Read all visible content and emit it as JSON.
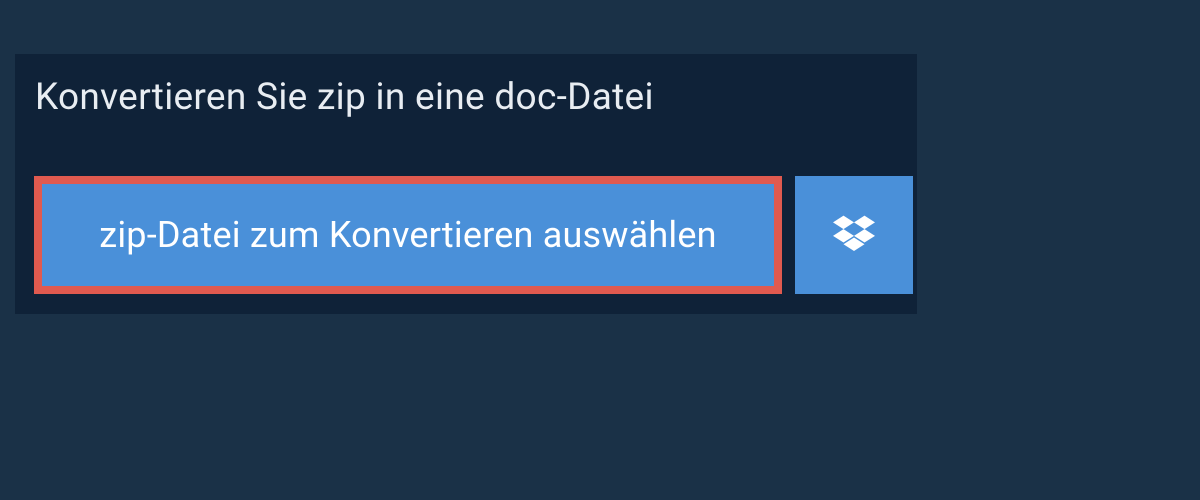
{
  "header": {
    "title": "Konvertieren Sie zip in eine doc-Datei"
  },
  "actions": {
    "select_file_label": "zip-Datei zum Konvertieren auswählen",
    "dropbox_icon_name": "dropbox"
  },
  "colors": {
    "background": "#1a3147",
    "panel": "#0f2238",
    "button_blue": "#4a90d9",
    "highlight_border": "#e05a4f"
  }
}
